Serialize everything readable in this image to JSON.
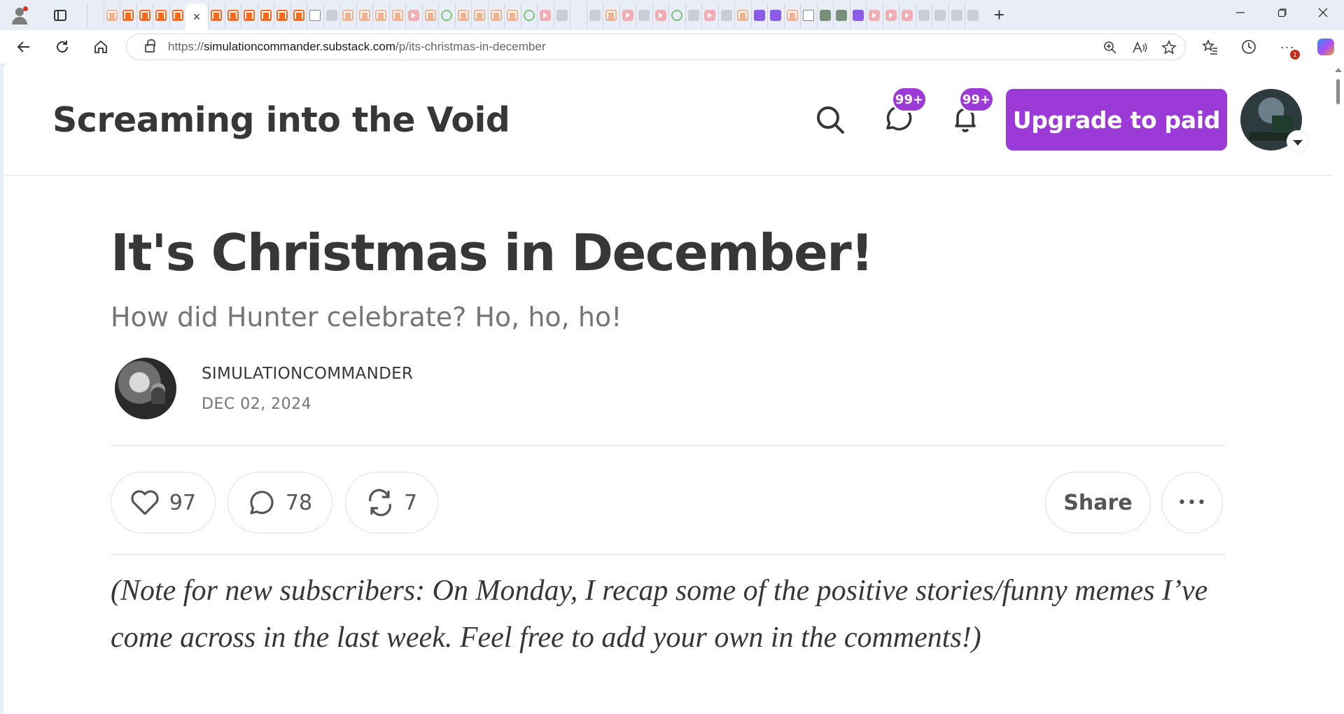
{
  "browser": {
    "tabs": [
      {
        "icon": "search"
      },
      {
        "icon": "pale"
      },
      {
        "icon": "substack"
      },
      {
        "icon": "substack"
      },
      {
        "icon": "substack"
      },
      {
        "icon": "substack"
      },
      {
        "icon": "active"
      },
      {
        "icon": "substack"
      },
      {
        "icon": "substack"
      },
      {
        "icon": "substack"
      },
      {
        "icon": "substack"
      },
      {
        "icon": "substack"
      },
      {
        "icon": "substack"
      },
      {
        "icon": "doc"
      },
      {
        "icon": "gray"
      },
      {
        "icon": "pale"
      },
      {
        "icon": "pale"
      },
      {
        "icon": "pale"
      },
      {
        "icon": "pale"
      },
      {
        "icon": "yt"
      },
      {
        "icon": "pale"
      },
      {
        "icon": "rumble"
      },
      {
        "icon": "pale"
      },
      {
        "icon": "pale"
      },
      {
        "icon": "pale"
      },
      {
        "icon": "pale"
      },
      {
        "icon": "rumble"
      },
      {
        "icon": "yt"
      },
      {
        "icon": "gray"
      },
      {
        "icon": "search"
      },
      {
        "icon": "gray"
      },
      {
        "icon": "pale"
      },
      {
        "icon": "yt"
      },
      {
        "icon": "gray"
      },
      {
        "icon": "yt"
      },
      {
        "icon": "rumble"
      },
      {
        "icon": "gray"
      },
      {
        "icon": "yt"
      },
      {
        "icon": "gray"
      },
      {
        "icon": "pale"
      },
      {
        "icon": "yahoo"
      },
      {
        "icon": "yahoo"
      },
      {
        "icon": "pale"
      },
      {
        "icon": "doc"
      },
      {
        "icon": "green"
      },
      {
        "icon": "green"
      },
      {
        "icon": "yahoo"
      },
      {
        "icon": "yt"
      },
      {
        "icon": "yt"
      },
      {
        "icon": "yt"
      },
      {
        "icon": "gray"
      },
      {
        "icon": "gray"
      },
      {
        "icon": "gray"
      },
      {
        "icon": "gray"
      }
    ],
    "active_tab_close": "×",
    "new_tab": "+",
    "url_prefix": "https://",
    "url_host": "simulationcommander.substack.com",
    "url_path": "/p/its-christmas-in-december",
    "notification_count": "1"
  },
  "site": {
    "title": "Screaming into the Void",
    "chat_badge": "99+",
    "bell_badge": "99+",
    "upgrade_label": "Upgrade to paid"
  },
  "post": {
    "title": "It's Christmas in December!",
    "subtitle": "How did Hunter celebrate? Ho, ho, ho!",
    "author": "SIMULATIONCOMMANDER",
    "date": "DEC 02, 2024",
    "likes": "97",
    "comments": "78",
    "restacks": "7",
    "share_label": "Share",
    "more_label": "•••",
    "body": "(Note for new subscribers: On Monday, I recap some of the positive stories/funny memes I’ve come across in the last week. Feel free to add your own in the comments!)"
  },
  "colors": {
    "accent": "#9b3ad7",
    "substack": "#ff6719"
  }
}
